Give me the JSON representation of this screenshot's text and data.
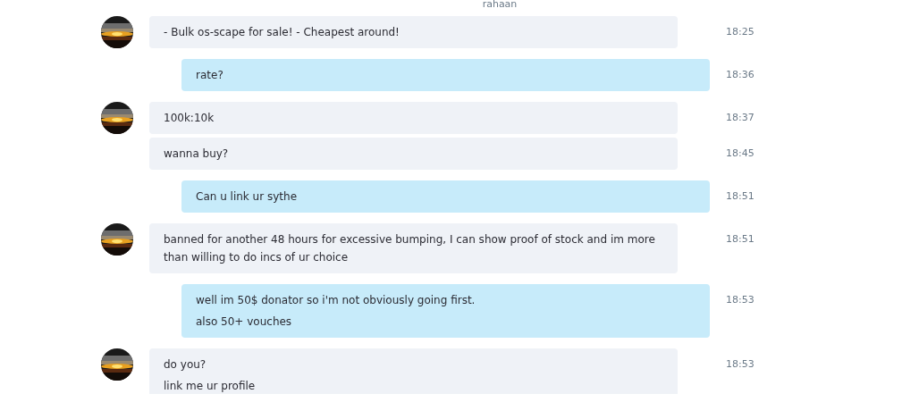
{
  "conversation": {
    "header": "rahaan"
  },
  "messages": [
    {
      "kind": "incoming",
      "avatar": true,
      "lines": [
        "- Bulk os-scape for sale! - Cheapest around!"
      ],
      "time": "18:25"
    },
    {
      "kind": "outgoing",
      "avatar": false,
      "lines": [
        "rate?"
      ],
      "time": "18:36"
    },
    {
      "kind": "incoming",
      "avatar": true,
      "lines": [
        "100k:10k"
      ],
      "time": "18:37"
    },
    {
      "kind": "incoming",
      "avatar": false,
      "lines": [
        "wanna buy?"
      ],
      "time": "18:45"
    },
    {
      "kind": "outgoing",
      "avatar": false,
      "lines": [
        "Can u link ur sythe"
      ],
      "time": "18:51"
    },
    {
      "kind": "incoming",
      "avatar": true,
      "lines": [
        "banned for another 48 hours for excessive bumping, I can show proof of stock and im more than willing to do incs of ur choice"
      ],
      "time": "18:51"
    },
    {
      "kind": "outgoing",
      "avatar": false,
      "lines": [
        "well im 50$ donator so i'm not obviously going first.",
        "also 50+ vouches"
      ],
      "time": "18:53"
    },
    {
      "kind": "incoming",
      "avatar": true,
      "lines": [
        "do you?",
        "link me ur profile"
      ],
      "time": "18:53"
    }
  ]
}
